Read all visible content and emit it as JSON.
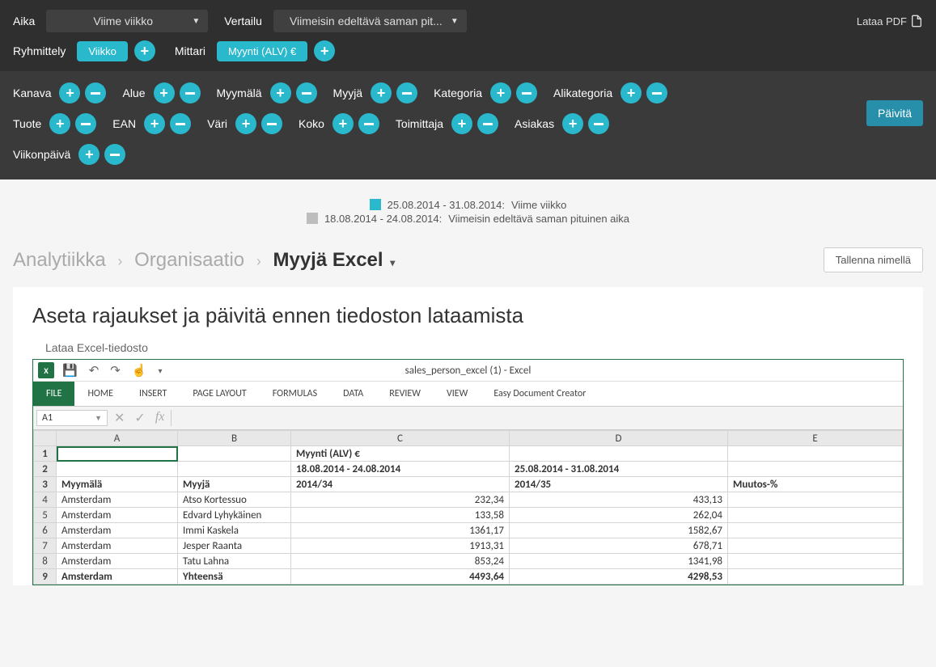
{
  "top": {
    "aika_label": "Aika",
    "aika_value": "Viime viikko",
    "vertailu_label": "Vertailu",
    "vertailu_value": "Viimeisin edeltävä saman pit...",
    "pdf_label": "Lataa PDF",
    "ryhmittely_label": "Ryhmittely",
    "ryhmittely_pill": "Viikko",
    "mittari_label": "Mittari",
    "mittari_pill": "Myynti (ALV) €"
  },
  "filters": {
    "kanava": "Kanava",
    "alue": "Alue",
    "myymala": "Myymälä",
    "myyja": "Myyjä",
    "kategoria": "Kategoria",
    "alikategoria": "Alikategoria",
    "tuote": "Tuote",
    "ean": "EAN",
    "vari": "Väri",
    "koko": "Koko",
    "toimittaja": "Toimittaja",
    "asiakas": "Asiakas",
    "viikonpaiva": "Viikonpäivä",
    "refresh": "Päivitä"
  },
  "legend": {
    "range1": "25.08.2014 - 31.08.2014:",
    "label1": "Viime viikko",
    "range2": "18.08.2014 - 24.08.2014:",
    "label2": "Viimeisin edeltävä saman pituinen aika"
  },
  "breadcrumb": {
    "a": "Analytiikka",
    "b": "Organisaatio",
    "c": "Myyjä Excel",
    "save": "Tallenna nimellä"
  },
  "panel": {
    "title": "Aseta rajaukset ja päivitä ennen tiedoston lataamista",
    "download": "Lataa Excel-tiedosto"
  },
  "excel": {
    "title": "sales_person_excel (1) - Excel",
    "namebox": "A1",
    "tabs": {
      "file": "FILE",
      "home": "HOME",
      "insert": "INSERT",
      "pagelayout": "PAGE LAYOUT",
      "formulas": "FORMULAS",
      "data": "DATA",
      "review": "REVIEW",
      "view": "VIEW",
      "edc": "Easy Document Creator"
    },
    "cols": [
      "A",
      "B",
      "C",
      "D",
      "E"
    ],
    "rows": [
      {
        "n": "1",
        "a": "",
        "b": "",
        "c": "Myynti (ALV) €",
        "d": "",
        "e": "",
        "bold": true,
        "sel": true
      },
      {
        "n": "2",
        "a": "",
        "b": "",
        "c": "18.08.2014 - 24.08.2014",
        "d": "25.08.2014 - 31.08.2014",
        "e": "",
        "bold": true
      },
      {
        "n": "3",
        "a": "Myymälä",
        "b": "Myyjä",
        "c": "2014/34",
        "d": "2014/35",
        "e": "Muutos-%",
        "bold": true
      },
      {
        "n": "4",
        "a": "Amsterdam",
        "b": "Atso Kortessuo",
        "c": "232,34",
        "d": "433,13",
        "e": ""
      },
      {
        "n": "5",
        "a": "Amsterdam",
        "b": "Edvard Lyhykäinen",
        "c": "133,58",
        "d": "262,04",
        "e": ""
      },
      {
        "n": "6",
        "a": "Amsterdam",
        "b": "Immi Kaskela",
        "c": "1361,17",
        "d": "1582,67",
        "e": ""
      },
      {
        "n": "7",
        "a": "Amsterdam",
        "b": "Jesper Raanta",
        "c": "1913,31",
        "d": "678,71",
        "e": ""
      },
      {
        "n": "8",
        "a": "Amsterdam",
        "b": "Tatu Lahna",
        "c": "853,24",
        "d": "1341,98",
        "e": ""
      },
      {
        "n": "9",
        "a": "Amsterdam",
        "b": "Yhteensä",
        "c": "4493,64",
        "d": "4298,53",
        "e": "",
        "bold": true
      }
    ]
  }
}
